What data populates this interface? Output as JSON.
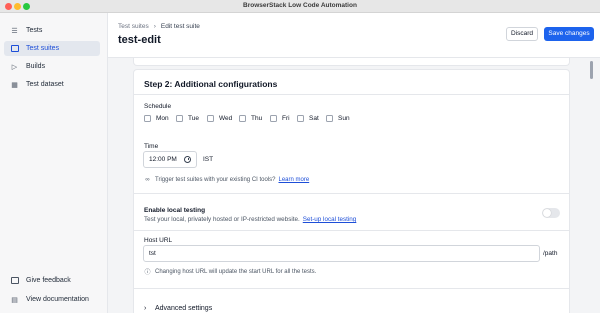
{
  "window": {
    "title": "BrowserStack Low Code Automation"
  },
  "sidebar": {
    "items": [
      {
        "label": "Tests",
        "icon": "list-icon",
        "active": false
      },
      {
        "label": "Test suites",
        "icon": "suites-icon",
        "active": true
      },
      {
        "label": "Builds",
        "icon": "play-icon",
        "active": false
      },
      {
        "label": "Test dataset",
        "icon": "table-icon",
        "active": false
      }
    ],
    "footer": [
      {
        "label": "Give feedback",
        "icon": "feedback-icon"
      },
      {
        "label": "View documentation",
        "icon": "document-icon"
      }
    ]
  },
  "header": {
    "breadcrumb": [
      "Test suites",
      "Edit test suite"
    ],
    "breadcrumb_sep": "›",
    "title": "test-edit",
    "discard_label": "Discard",
    "save_label": "Save changes"
  },
  "step": {
    "title": "Step 2: Additional configurations",
    "schedule_label": "Schedule",
    "days": [
      "Mon",
      "Tue",
      "Wed",
      "Thu",
      "Fri",
      "Sat",
      "Sun"
    ],
    "time_label": "Time",
    "time_value": "12:00 PM",
    "timezone": "IST",
    "ci_hint": "Trigger test suites with your existing CI tools?",
    "ci_link": "Learn more",
    "local_title": "Enable local testing",
    "local_desc": "Test your local, privately hosted or IP-restricted website.",
    "local_link": "Set-up local testing",
    "local_enabled": false,
    "host_label": "Host URL",
    "host_value": "tst",
    "host_suffix": "/path",
    "host_hint": "Changing host URL will update the start URL for all the tests.",
    "advanced_label": "Advanced settings"
  },
  "colors": {
    "primary": "#1d63ed",
    "link": "#1d4ed8",
    "active_nav_bg": "#e3e7ee"
  }
}
